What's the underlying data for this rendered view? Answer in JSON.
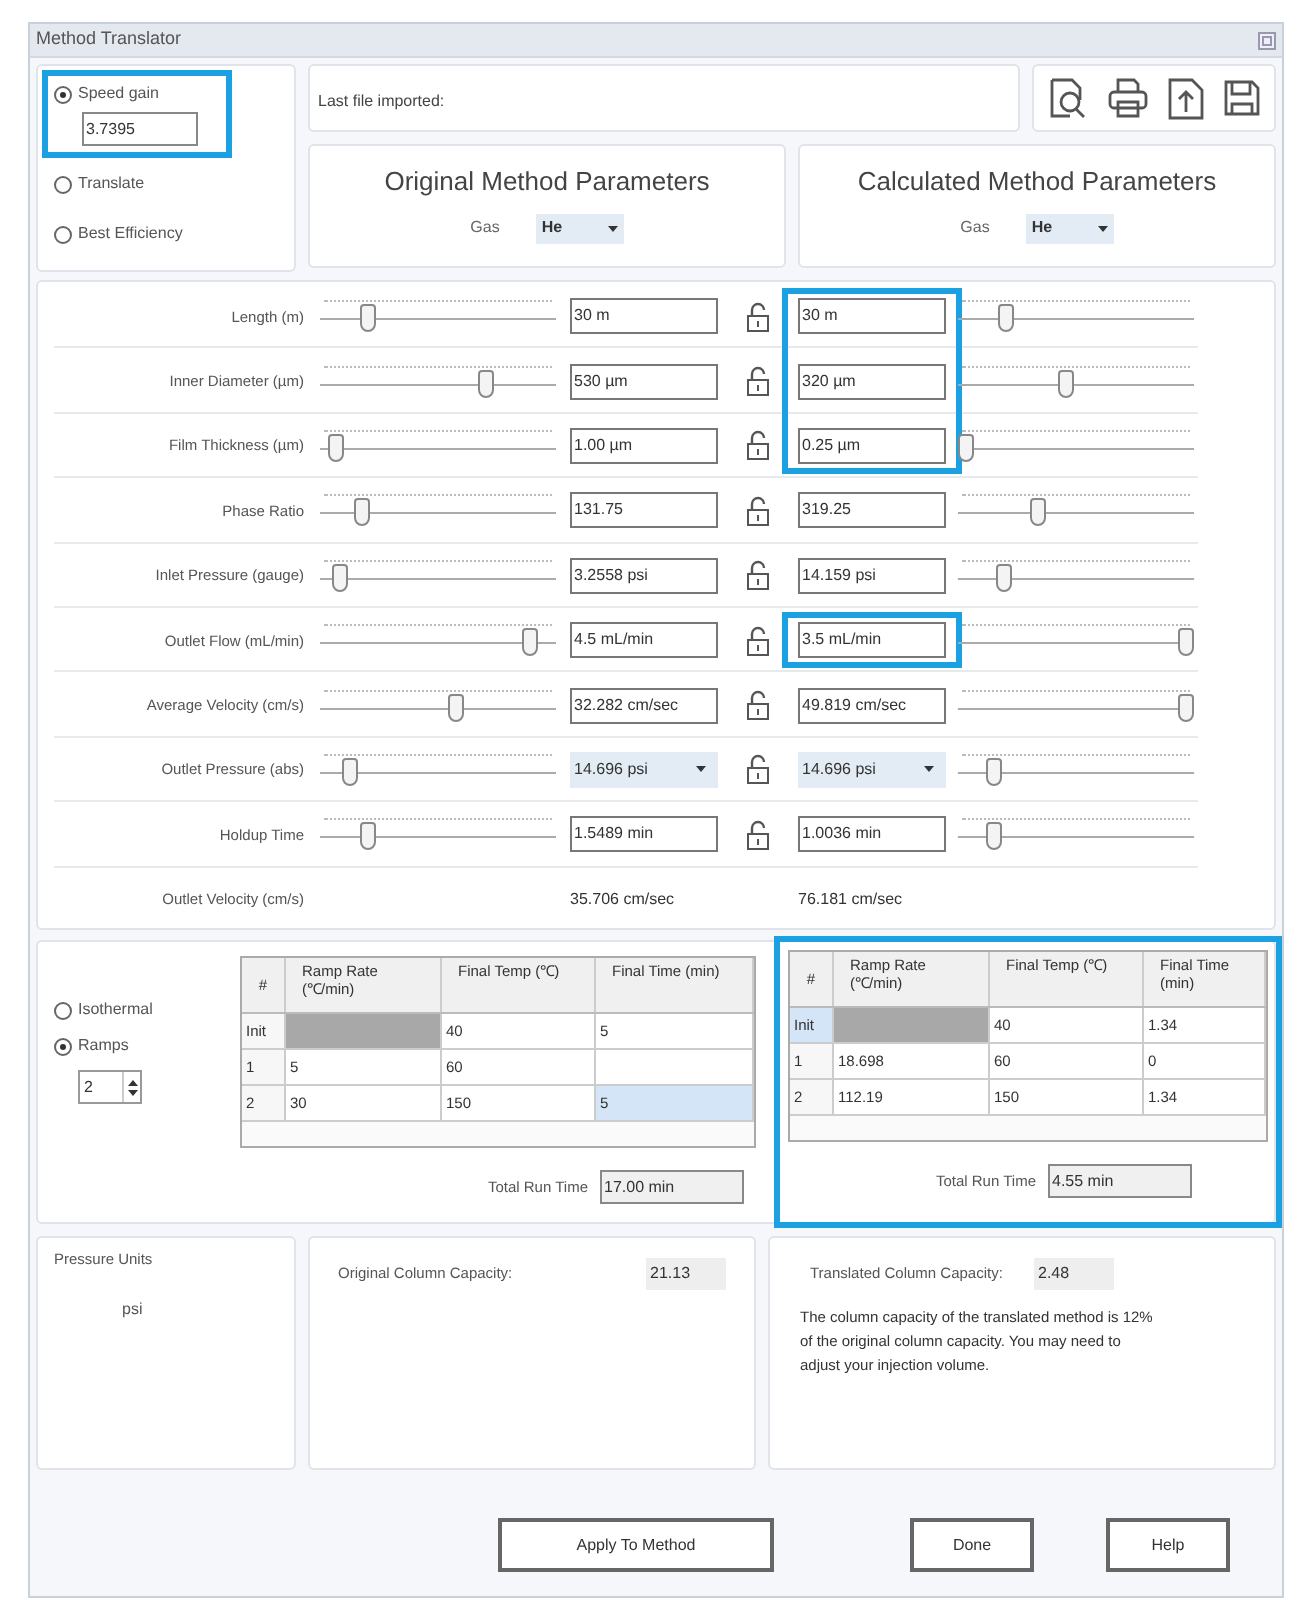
{
  "window": {
    "title": "Method Translator"
  },
  "modes": [
    {
      "label": "Speed gain",
      "selected": true,
      "highlighted": true,
      "value": "3.7395"
    },
    {
      "label": "Translate",
      "selected": false,
      "highlighted": false
    },
    {
      "label": "Best Efficiency",
      "selected": false,
      "highlighted": false
    }
  ],
  "last_file": {
    "label": "Last file imported:"
  },
  "original_header": {
    "title": "Original Method Parameters",
    "gas_label": "Gas",
    "gas": "He"
  },
  "calculated_header": {
    "title": "Calculated Method Parameters",
    "gas_label": "Gas",
    "gas": "He"
  },
  "parameters": [
    {
      "label": "Length (m)",
      "kind": "text",
      "original": "30 m",
      "original_slider": {
        "level": 0.18
      },
      "calculated": "30 m",
      "calculated_slider": {
        "level": 0.18
      },
      "highlighted": true
    },
    {
      "label": "Inner Diameter (µm)",
      "kind": "text",
      "original": "530 µm",
      "original_slider": {
        "level": 0.72
      },
      "calculated": "320 µm",
      "calculated_slider": {
        "level": 0.45
      },
      "highlighted": true
    },
    {
      "label": "Film Thickness (µm)",
      "kind": "text",
      "original": "1.00 µm",
      "original_slider": {
        "level": 0.04
      },
      "calculated": "0.25 µm",
      "calculated_slider": {
        "level": 0.0
      },
      "highlighted": true
    },
    {
      "label": "Phase Ratio",
      "kind": "text",
      "original": "131.75",
      "original_slider": {
        "level": 0.15
      },
      "calculated": "319.25",
      "calculated_slider": {
        "level": 0.33
      },
      "highlighted": false
    },
    {
      "label": "Inlet Pressure (gauge)",
      "kind": "text",
      "original": "3.2558 psi",
      "original_slider": {
        "level": 0.05
      },
      "calculated": "14.159 psi",
      "calculated_slider": {
        "level": 0.17
      },
      "highlighted": false
    },
    {
      "label": "Outlet Flow (mL/min)",
      "kind": "text",
      "original": "4.5 mL/min",
      "original_slider": {
        "level": 0.92
      },
      "calculated": "3.5 mL/min",
      "calculated_slider": {
        "level": 1.0
      },
      "highlighted": true
    },
    {
      "label": "Average Velocity (cm/s)",
      "kind": "text",
      "original": "32.282 cm/sec",
      "original_slider": {
        "level": 0.58
      },
      "calculated": "49.819 cm/sec",
      "calculated_slider": {
        "level": 1.0
      },
      "highlighted": false
    },
    {
      "label": "Outlet Pressure (abs)",
      "kind": "dropdown",
      "original": "14.696 psi",
      "original_slider": {
        "level": 0.1
      },
      "calculated": "14.696 psi",
      "calculated_slider": {
        "level": 0.13
      },
      "highlighted": false
    },
    {
      "label": "Holdup Time",
      "kind": "text",
      "original": "1.5489 min",
      "original_slider": {
        "level": 0.18
      },
      "calculated": "1.0036 min",
      "calculated_slider": {
        "level": 0.13
      },
      "highlighted": false
    },
    {
      "label": "Outlet Velocity (cm/s)",
      "kind": "readout",
      "original": "35.706 cm/sec",
      "calculated": "76.181 cm/sec",
      "highlighted": false
    }
  ],
  "oven": {
    "modes": [
      {
        "label": "Isothermal",
        "selected": false
      },
      {
        "label": "Ramps",
        "selected": true
      }
    ],
    "ramps": "2"
  },
  "programs": [
    {
      "highlighted": false,
      "columns": [
        "#",
        "Ramp Rate (℃/min)",
        "Final Temp (℃)",
        "Final Time (min)"
      ],
      "rows": [
        [
          {
            "kind": "text",
            "text": "Init",
            "selected": false
          },
          {
            "kind": "disabled"
          },
          {
            "kind": "text",
            "text": "40",
            "selected": false
          },
          {
            "kind": "text",
            "text": "5",
            "selected": false
          }
        ],
        [
          {
            "kind": "text",
            "text": "1",
            "selected": false
          },
          {
            "kind": "text",
            "text": "5",
            "selected": false
          },
          {
            "kind": "text",
            "text": "60",
            "selected": false
          },
          {
            "kind": "blank"
          }
        ],
        [
          {
            "kind": "text",
            "text": "2",
            "selected": false
          },
          {
            "kind": "text",
            "text": "30",
            "selected": false
          },
          {
            "kind": "text",
            "text": "150",
            "selected": false
          },
          {
            "kind": "text",
            "text": "5",
            "selected": true
          }
        ]
      ],
      "total_label": "Total Run Time",
      "total": "17.00 min"
    },
    {
      "highlighted": true,
      "columns": [
        "#",
        "Ramp Rate (℃/min)",
        "Final Temp (℃)",
        "Final Time (min)"
      ],
      "rows": [
        [
          {
            "kind": "text",
            "text": "Init",
            "selected": true
          },
          {
            "kind": "disabled"
          },
          {
            "kind": "text",
            "text": "40",
            "selected": false
          },
          {
            "kind": "text",
            "text": "1.34",
            "selected": false
          }
        ],
        [
          {
            "kind": "text",
            "text": "1",
            "selected": false
          },
          {
            "kind": "text",
            "text": "18.698",
            "selected": false
          },
          {
            "kind": "text",
            "text": "60",
            "selected": false
          },
          {
            "kind": "text",
            "text": "0",
            "selected": false
          }
        ],
        [
          {
            "kind": "text",
            "text": "2",
            "selected": false
          },
          {
            "kind": "text",
            "text": "112.19",
            "selected": false
          },
          {
            "kind": "text",
            "text": "150",
            "selected": false
          },
          {
            "kind": "text",
            "text": "1.34",
            "selected": false
          }
        ]
      ],
      "total_label": "Total Run Time",
      "total": "4.55 min"
    }
  ],
  "pressure_units": {
    "title": "Pressure Units",
    "value": "psi"
  },
  "original_capacity": {
    "label": "Original Column Capacity:",
    "value": "21.13"
  },
  "translated_capacity": {
    "label": "Translated Column Capacity:",
    "value": "2.48",
    "note": "The column capacity of the translated method is 12% of the original column capacity. You may need to adjust your injection volume."
  },
  "buttons": [
    "Apply To Method",
    "Done",
    "Help"
  ]
}
